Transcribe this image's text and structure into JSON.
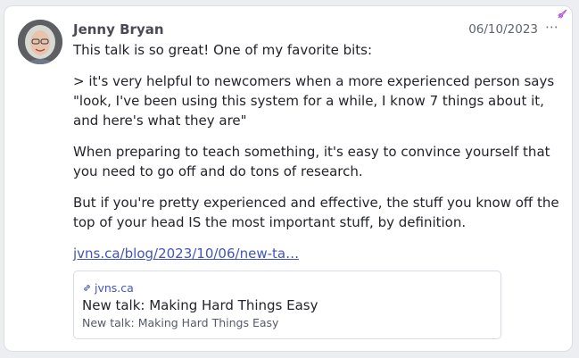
{
  "post": {
    "author": "Jenny Bryan",
    "date": "06/10/2023",
    "more_label": "⋯",
    "paragraphs": [
      "This talk is so great! One of my favorite bits:",
      "> it's very helpful to newcomers when a more experienced person says \"look, I've been using this system for a while, I know 7 things about it, and here's what they are\"",
      "When preparing to teach something, it's easy to convince yourself that you need to go off and do tons of research.",
      "But if you're pretty experienced and effective, the stuff you know off the top of your head IS the most important stuff, by definition."
    ],
    "link_text": "jvns.ca/blog/2023/10/06/new-ta…"
  },
  "preview": {
    "domain": "jvns.ca",
    "title": "New talk: Making Hard Things Easy",
    "description": "New talk: Making Hard Things Easy"
  },
  "icons": {
    "boost": "rocket-icon",
    "link": "link-icon",
    "more": "more-icon"
  },
  "colors": {
    "link": "#4156b8",
    "boost": "#b04fd6",
    "background": "#eceef2"
  }
}
